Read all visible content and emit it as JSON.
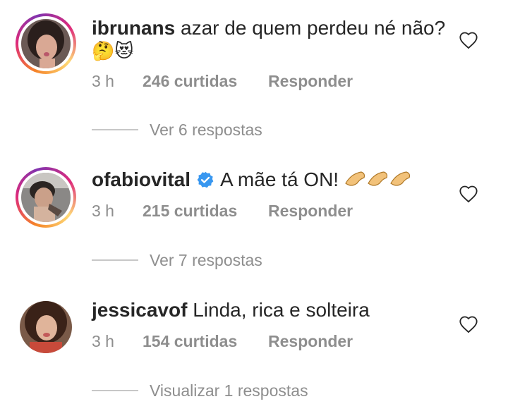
{
  "comments": [
    {
      "username": "ibrunans",
      "text": "azar de quem perdeu né não?",
      "emoji_line": "🤔😻",
      "time": "3 h",
      "likes": "246 curtidas",
      "reply": "Responder",
      "view_replies": "Ver 6 respostas"
    },
    {
      "username": "ofabiovital",
      "text": "A mãe tá ON!",
      "emojis": "👏👏👏",
      "time": "3 h",
      "likes": "215 curtidas",
      "reply": "Responder",
      "view_replies": "Ver 7 respostas"
    },
    {
      "username": "jessicavof",
      "text": "Linda, rica e solteira",
      "time": "3 h",
      "likes": "154 curtidas",
      "reply": "Responder",
      "view_replies": "Visualizar 1 respostas"
    }
  ],
  "colors": {
    "text": "#262626",
    "muted": "#8e8e8e",
    "verified": "#3897f0"
  }
}
